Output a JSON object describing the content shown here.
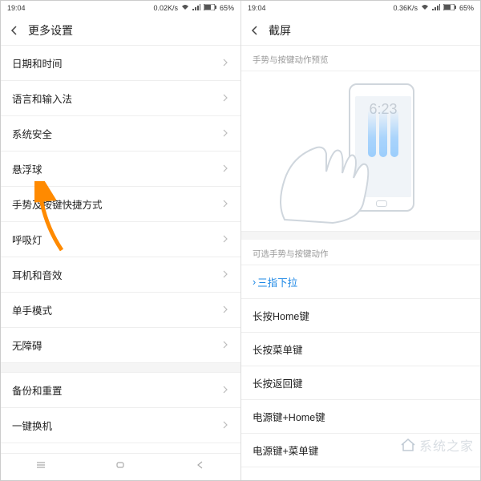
{
  "left": {
    "status": {
      "time": "19:04",
      "net_speed": "0.02K/s",
      "battery": "65%"
    },
    "title": "更多设置",
    "rows": [
      "日期和时间",
      "语言和输入法",
      "系统安全",
      "悬浮球",
      "手势及按键快捷方式",
      "呼吸灯",
      "耳机和音效",
      "单手模式",
      "无障碍"
    ],
    "rows2": [
      "备份和重置",
      "一键换机"
    ]
  },
  "right": {
    "status": {
      "time": "19:04",
      "net_speed": "0.36K/s",
      "battery": "65%"
    },
    "title": "截屏",
    "preview_label": "手势与按键动作预览",
    "phone_time": "6:23",
    "options_label": "可选手势与按键动作",
    "options": [
      {
        "label": "三指下拉",
        "selected": true
      },
      {
        "label": "长按Home键",
        "selected": false
      },
      {
        "label": "长按菜单键",
        "selected": false
      },
      {
        "label": "长按返回键",
        "selected": false
      },
      {
        "label": "电源键+Home键",
        "selected": false
      },
      {
        "label": "电源键+菜单键",
        "selected": false
      }
    ]
  },
  "watermark": "系统之家"
}
